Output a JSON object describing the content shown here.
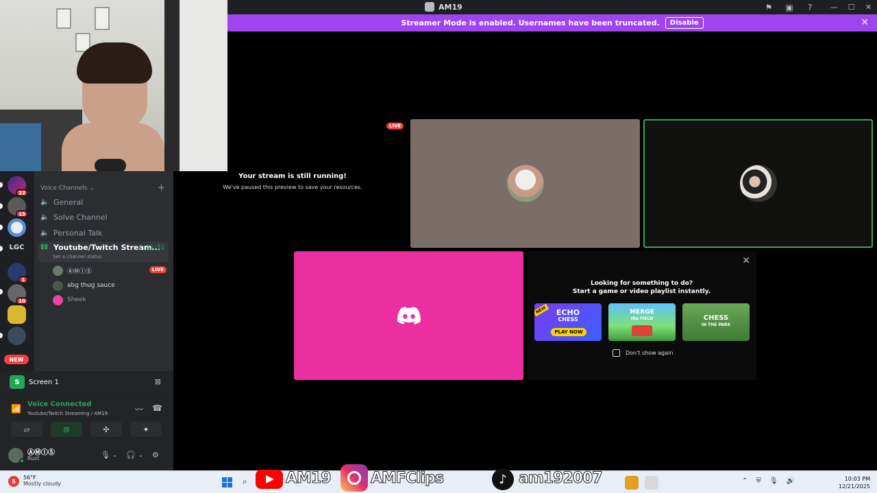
{
  "window": {
    "title": "AM19",
    "controls": [
      "—",
      "☐",
      "✕"
    ]
  },
  "banner": {
    "text": "Streamer Mode is enabled. Usernames have been truncated.",
    "button": "Disable"
  },
  "servers": {
    "badges": [
      "22",
      "15",
      "1",
      "10"
    ],
    "text_server": "LGC",
    "new_label": "NEW"
  },
  "sidebar": {
    "category": "Voice Channels",
    "channels": [
      {
        "name": "General"
      },
      {
        "name": "Solve Channel"
      },
      {
        "name": "Personal Talk"
      }
    ],
    "active_channel": {
      "name": "Youtube/Twitch Stream...",
      "time": "2:33:51",
      "status": "Set a channel status"
    },
    "users": [
      {
        "name": "ⒶⓂⒾⓈ",
        "live": "LIVE"
      },
      {
        "name": "abg thug sauce"
      },
      {
        "name": "Sheek"
      }
    ]
  },
  "screen_share": {
    "label": "Screen 1"
  },
  "voice": {
    "status": "Voice Connected",
    "location": "Youtube/Twitch Streaming / AM19"
  },
  "user": {
    "name": "ⒶⓂⒾⓈ",
    "activity": "Rust"
  },
  "stage": {
    "paused_title": "Your stream is still running!",
    "paused_sub": "We've paused this preview to save your resources.",
    "live_tag": "LIVE"
  },
  "activity": {
    "title": "Looking for something to do?",
    "subtitle": "Start a game or video playlist instantly.",
    "games": [
      {
        "title": "ECHO",
        "sub": "CHESS",
        "cta": "PLAY NOW",
        "tag": "NEW"
      },
      {
        "title": "MERGE",
        "sub": "the FIELD"
      },
      {
        "title": "CHESS",
        "sub": "IN THE PARK"
      }
    ],
    "checkbox": "Don't show again"
  },
  "taskbar": {
    "badge": "5",
    "temp": "56°F",
    "weather": "Mostly cloudy",
    "time": "10:03 PM",
    "date": "12/21/2025",
    "overlay": [
      "AM19",
      "AMFClips",
      "am192007"
    ]
  }
}
